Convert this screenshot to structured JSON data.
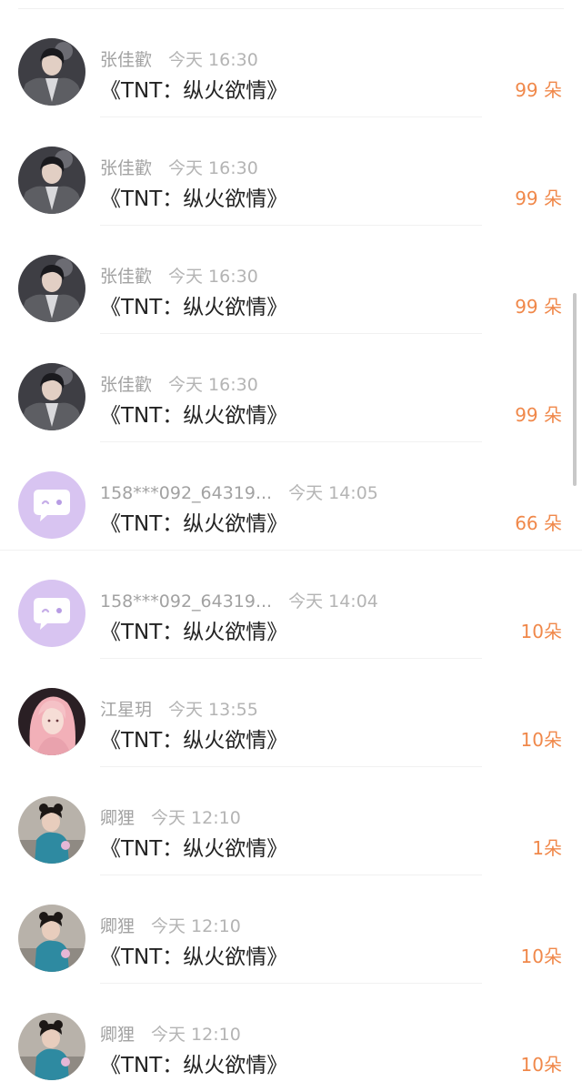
{
  "gift_list": [
    {
      "user": "张佳歡",
      "time": "今天 16:30",
      "title": "《TNT：纵火欲情》",
      "amount": "99 朵",
      "avatar": "avatar-boy"
    },
    {
      "user": "张佳歡",
      "time": "今天 16:30",
      "title": "《TNT：纵火欲情》",
      "amount": "99 朵",
      "avatar": "avatar-boy"
    },
    {
      "user": "张佳歡",
      "time": "今天 16:30",
      "title": "《TNT：纵火欲情》",
      "amount": "99 朵",
      "avatar": "avatar-boy"
    },
    {
      "user": "张佳歡",
      "time": "今天 16:30",
      "title": "《TNT：纵火欲情》",
      "amount": "99 朵",
      "avatar": "avatar-boy"
    },
    {
      "user": "158***092_64319...",
      "time": "今天 14:05",
      "title": "《TNT：纵火欲情》",
      "amount": "66 朵",
      "avatar": "avatar-default-chat"
    },
    {
      "user": "158***092_64319...",
      "time": "今天 14:04",
      "title": "《TNT：纵火欲情》",
      "amount": "10朵",
      "avatar": "avatar-default-chat"
    },
    {
      "user": "江星玥",
      "time": "今天 13:55",
      "title": "《TNT：纵火欲情》",
      "amount": "10朵",
      "avatar": "avatar-girl-pink"
    },
    {
      "user": "卿狸",
      "time": "今天 12:10",
      "title": "《TNT：纵火欲情》",
      "amount": "1朵",
      "avatar": "avatar-girl-teal"
    },
    {
      "user": "卿狸",
      "time": "今天 12:10",
      "title": "《TNT：纵火欲情》",
      "amount": "10朵",
      "avatar": "avatar-girl-teal"
    },
    {
      "user": "卿狸",
      "time": "今天 12:10",
      "title": "《TNT：纵火欲情》",
      "amount": "10朵",
      "avatar": "avatar-girl-teal"
    }
  ],
  "colors": {
    "amount": "#f0884a",
    "meta": "#a2a2a2",
    "title": "#222222",
    "default_avatar": "#d8c4f1"
  }
}
